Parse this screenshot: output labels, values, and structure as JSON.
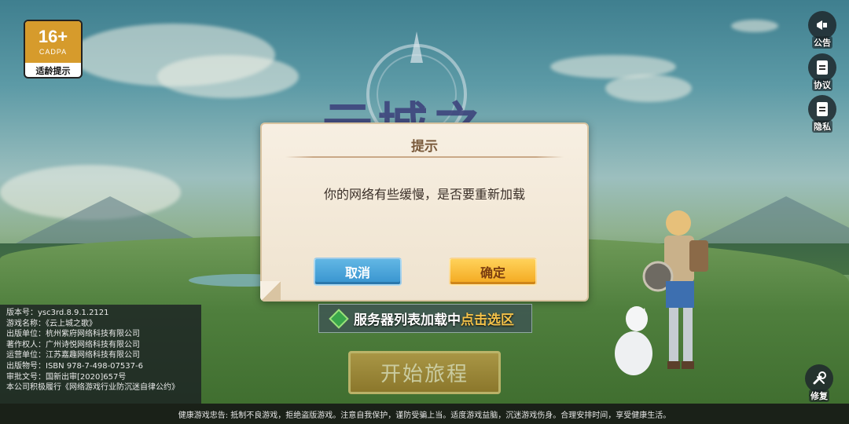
{
  "age_badge": {
    "rating": "16+",
    "org": "CADPA",
    "label": "适龄提示"
  },
  "side_buttons": [
    {
      "label": "公告",
      "icon": "megaphone-icon"
    },
    {
      "label": "协议",
      "icon": "document-icon"
    },
    {
      "label": "隐私",
      "icon": "document-icon"
    }
  ],
  "logo_text": "云城之",
  "dialog": {
    "title": "提示",
    "message": "你的网络有些缓慢，是否要重新加载",
    "cancel_label": "取消",
    "confirm_label": "确定"
  },
  "server": {
    "status": "服务器列表加载中",
    "link": "点击选区"
  },
  "start_label": "开始旅程",
  "info_lines": [
    "版本号：ysc3rd.8.9.1.2121",
    "游戏名称：《云上城之歌》",
    "出版单位：杭州紫府网络科技有限公司",
    "著作权人：广州诗悦网络科技有限公司",
    "运营单位：江苏嘉趣网络科技有限公司",
    "出版物号：ISBN 978-7-498-07537-6",
    "审批文号：国新出审[2020]657号",
    "本公司积极履行《网络游戏行业防沉迷自律公约》"
  ],
  "repair_label": "修复",
  "notice": "健康游戏忠告: 抵制不良游戏，拒绝盗版游戏。注意自我保护，谨防受骗上当。适度游戏益脑，沉迷游戏伤身。合理安排时间，享受健康生活。",
  "colors": {
    "cancel": "#3793cf",
    "confirm": "#f3a81f",
    "badge": "#d69b2c",
    "link": "#f3c24a"
  }
}
